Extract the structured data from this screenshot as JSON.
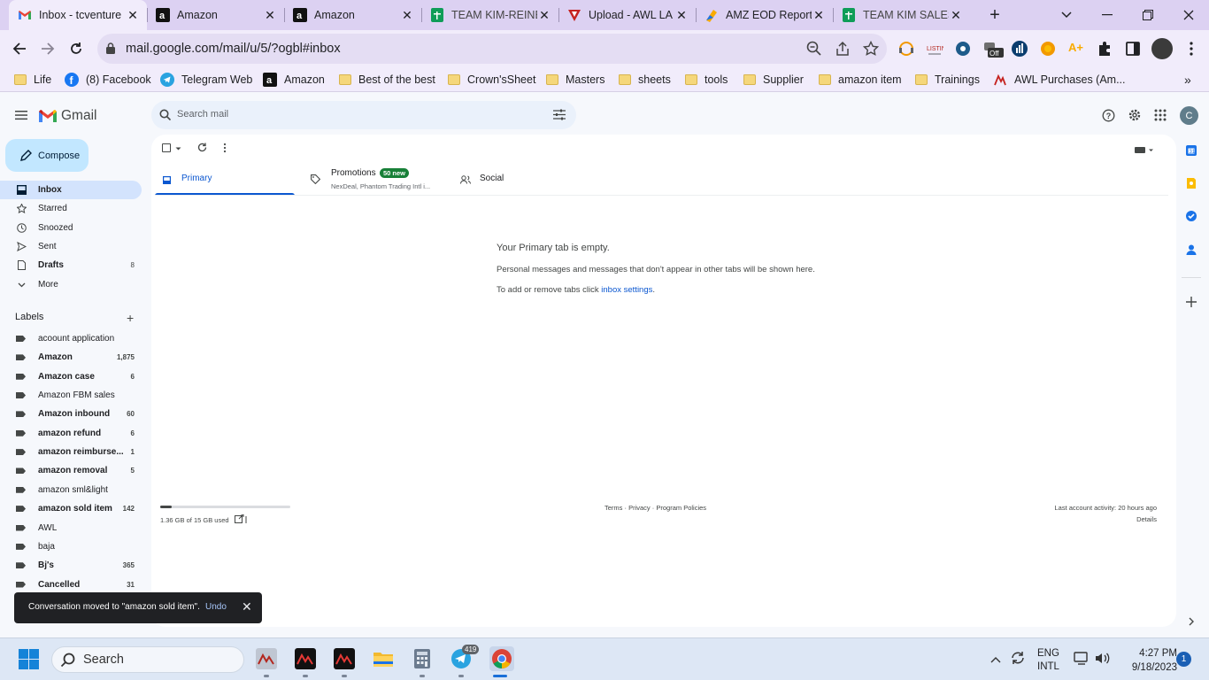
{
  "browser": {
    "tabs": [
      {
        "title": "Inbox - tcventure",
        "icon": "gmail-icon",
        "active": true
      },
      {
        "title": "Amazon",
        "icon": "amazon-icon"
      },
      {
        "title": "Amazon",
        "icon": "amazon-icon"
      },
      {
        "title": "TEAM KIM-REINE",
        "icon": "sheets-icon"
      },
      {
        "title": "Upload - AWL LA",
        "icon": "upload-icon"
      },
      {
        "title": "AMZ EOD Report",
        "icon": "report-icon"
      },
      {
        "title": "TEAM KIM SALES",
        "icon": "sheets-icon"
      }
    ],
    "url": "mail.google.com/mail/u/5/?ogbl#inbox",
    "bookmarks": [
      "Life",
      "(8) Facebook",
      "Telegram Web",
      "Amazon",
      "Best of the best",
      "Crown'sSheet",
      "Masters",
      "sheets",
      "tools",
      "Supplier",
      "amazon item",
      "Trainings",
      "AWL Purchases (Am..."
    ],
    "ext_badge": "Off"
  },
  "gmail": {
    "logo": "Gmail",
    "search_placeholder": "Search mail",
    "compose": "Compose",
    "avatar": "C",
    "nav": [
      {
        "label": "Inbox",
        "count": ""
      },
      {
        "label": "Starred",
        "count": ""
      },
      {
        "label": "Snoozed",
        "count": ""
      },
      {
        "label": "Sent",
        "count": ""
      },
      {
        "label": "Drafts",
        "count": "8"
      },
      {
        "label": "More",
        "count": ""
      }
    ],
    "labels_heading": "Labels",
    "labels": [
      {
        "name": "acoount application",
        "count": ""
      },
      {
        "name": "Amazon",
        "count": "1,875"
      },
      {
        "name": "Amazon case",
        "count": "6"
      },
      {
        "name": "Amazon FBM sales",
        "count": ""
      },
      {
        "name": "Amazon inbound",
        "count": "60"
      },
      {
        "name": "amazon refund",
        "count": "6"
      },
      {
        "name": "amazon reimburse...",
        "count": "1"
      },
      {
        "name": "amazon removal",
        "count": "5"
      },
      {
        "name": "amazon sml&light",
        "count": ""
      },
      {
        "name": "amazon sold item",
        "count": "142"
      },
      {
        "name": "AWL",
        "count": ""
      },
      {
        "name": "baja",
        "count": ""
      },
      {
        "name": "Bj's",
        "count": "365"
      },
      {
        "name": "Cancelled",
        "count": "31"
      }
    ],
    "tabs": {
      "primary": "Primary",
      "promotions": "Promotions",
      "promotions_badge": "50 new",
      "promotions_sub": "NexDeal, Phantom Trading Intl i...",
      "social": "Social"
    },
    "empty": {
      "title": "Your Primary tab is empty.",
      "body": "Personal messages and messages that don't appear in other tabs will be shown here.",
      "link_prefix": "To add or remove tabs click ",
      "link": "inbox settings",
      "link_suffix": "."
    },
    "footer": {
      "storage": "1.36 GB of 15 GB used",
      "storage_fraction": 0.09,
      "terms": "Terms",
      "privacy": "Privacy",
      "policies": "Program Policies",
      "sep": " · ",
      "activity": "Last account activity: 20 hours ago",
      "details": "Details"
    },
    "toast": {
      "message": "Conversation moved to \"amazon sold item\".",
      "undo": "Undo"
    }
  },
  "taskbar": {
    "search": "Search",
    "telegram_badge": "419",
    "lang": "ENG",
    "layout": "INTL",
    "time": "4:27 PM",
    "date": "9/18/2023",
    "notifications": "1"
  },
  "colors": {
    "gmail_red": "#ea4335",
    "compose_bg": "#c2e7ff",
    "inbox_active": "#d3e3fd",
    "tab_accent": "#0b57d0",
    "promo_badge": "#188038"
  }
}
